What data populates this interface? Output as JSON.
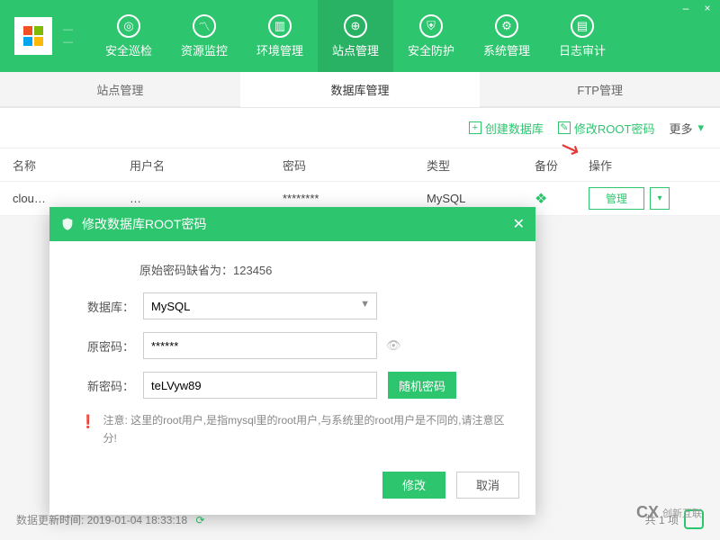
{
  "window": {
    "minimize": "–",
    "close": "×"
  },
  "nav": {
    "items": [
      {
        "label": "安全巡检",
        "glyph": "◎"
      },
      {
        "label": "资源监控",
        "glyph": "〽"
      },
      {
        "label": "环境管理",
        "glyph": "▥"
      },
      {
        "label": "站点管理",
        "glyph": "⊕"
      },
      {
        "label": "安全防护",
        "glyph": "⛨"
      },
      {
        "label": "系统管理",
        "glyph": "⚙"
      },
      {
        "label": "日志审计",
        "glyph": "▤"
      }
    ],
    "active_index": 3
  },
  "subtabs": {
    "items": [
      "站点管理",
      "数据库管理",
      "FTP管理"
    ],
    "active_index": 1
  },
  "toolbar": {
    "create_db": "创建数据库",
    "change_root": "修改ROOT密码",
    "more": "更多"
  },
  "table": {
    "headers": {
      "name": "名称",
      "user": "用户名",
      "password": "密码",
      "type": "类型",
      "backup": "备份",
      "ops": "操作"
    },
    "rows": [
      {
        "name": "clou…",
        "user": "…",
        "password": "********",
        "type": "MySQL",
        "manage": "管理"
      }
    ]
  },
  "footer": {
    "update_label": "数据更新时间:",
    "update_time": "2019-01-04 18:33:18",
    "pager": "共 1 项"
  },
  "brand": {
    "cx": "CX",
    "text": "创新互联"
  },
  "modal": {
    "title": "修改数据库ROOT密码",
    "default_hint": "原始密码缺省为：123456",
    "labels": {
      "db": "数据库：",
      "old": "原密码：",
      "new": "新密码："
    },
    "db_value": "MySQL",
    "old_value": "******",
    "new_value": "teLVyw89",
    "random": "随机密码",
    "warn": "注意: 这里的root用户,是指mysql里的root用户,与系统里的root用户是不同的,请注意区分!",
    "ok": "修改",
    "cancel": "取消"
  }
}
